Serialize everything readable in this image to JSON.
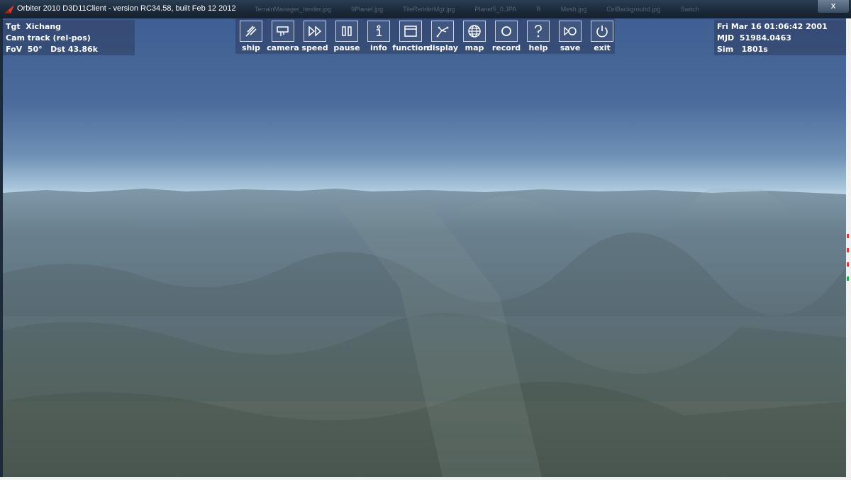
{
  "window": {
    "title": "Orbiter 2010 D3D11Client - version RC34.58, built Feb 12 2012",
    "close_label": "x",
    "background_tabs": [
      "TerrainManager_render.jpg",
      "9Planet.jpg",
      "TileRenderMgr.jpg",
      "Planet5_0.JPA",
      "R",
      "Mesh.jpg",
      "CelBackground.jpg",
      "Switch"
    ]
  },
  "hud_left": {
    "lines": [
      "Tgt  Xichang",
      "Cam track (rel-pos)",
      "FoV  50°   Dst 43.86k"
    ]
  },
  "hud_right": {
    "lines": [
      "Fri Mar 16 01:06:42 2001",
      "MJD  51984.0463",
      "Sim   1801s"
    ]
  },
  "toolbar": {
    "buttons": [
      {
        "label": "ship",
        "icon": "ship-icon"
      },
      {
        "label": "camera",
        "icon": "camera-icon"
      },
      {
        "label": "speed",
        "icon": "fast-forward-icon"
      },
      {
        "label": "pause",
        "icon": "pause-icon"
      },
      {
        "label": "info",
        "icon": "info-icon"
      },
      {
        "label": "function",
        "icon": "window-icon"
      },
      {
        "label": "display",
        "icon": "display-icon"
      },
      {
        "label": "map",
        "icon": "globe-icon"
      },
      {
        "label": "record",
        "icon": "record-icon"
      },
      {
        "label": "help",
        "icon": "help-icon"
      },
      {
        "label": "save",
        "icon": "save-icon"
      },
      {
        "label": "exit",
        "icon": "power-icon"
      }
    ]
  },
  "colors": {
    "titlebar": "#1c2a3a",
    "hud_panel": "#2d3c5f",
    "sky_top": "#3f5f93",
    "horizon": "#d4e6f1",
    "terrain": "#5a6b68"
  }
}
